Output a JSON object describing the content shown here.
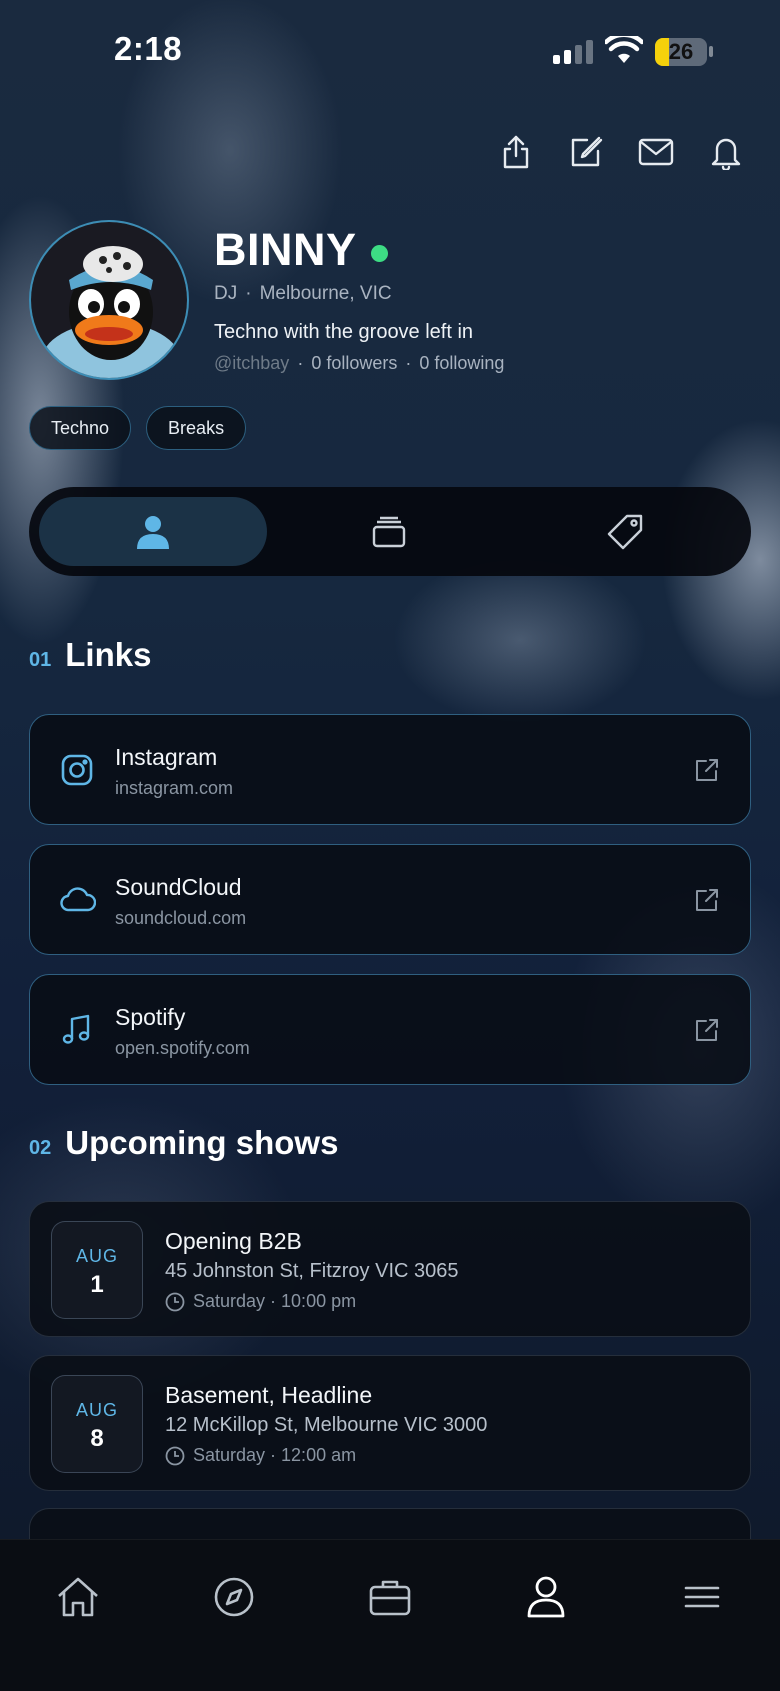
{
  "status_bar": {
    "time": "2:18",
    "battery": "26"
  },
  "profile": {
    "name": "BINNY",
    "role": "DJ",
    "location": "Melbourne, VIC",
    "bio": "Techno with the groove left in",
    "handle": "@itchbay",
    "followers": "0 followers",
    "following": "0 following",
    "tags": [
      "Techno",
      "Breaks"
    ],
    "online_color": "#3ddc84"
  },
  "links_section": {
    "number": "01",
    "title": "Links"
  },
  "links": [
    {
      "name": "Instagram",
      "url": "instagram.com",
      "icon": "instagram-icon"
    },
    {
      "name": "SoundCloud",
      "url": "soundcloud.com",
      "icon": "cloud-icon"
    },
    {
      "name": "Spotify",
      "url": "open.spotify.com",
      "icon": "music-note-icon"
    }
  ],
  "shows_section": {
    "number": "02",
    "title": "Upcoming shows"
  },
  "shows": [
    {
      "month": "AUG",
      "day": "1",
      "title": "Opening B2B",
      "address": "45 Johnston St, Fitzroy VIC 3065",
      "time": "Saturday · 10:00 pm"
    },
    {
      "month": "AUG",
      "day": "8",
      "title": "Basement, Headline",
      "address": "12 McKillop St, Melbourne VIC 3000",
      "time": "Saturday · 12:00 am"
    }
  ],
  "accent_color": "#5fb6e6"
}
